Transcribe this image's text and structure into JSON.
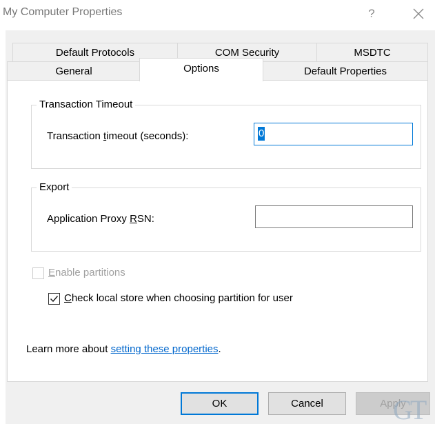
{
  "window": {
    "title": "My Computer Properties",
    "help_glyph": "?"
  },
  "tabs": {
    "row1": [
      "Default Protocols",
      "COM Security",
      "MSDTC"
    ],
    "row2": [
      "General",
      "Options",
      "Default Properties"
    ],
    "active": "Options"
  },
  "transaction_timeout": {
    "legend": "Transaction Timeout",
    "label_before": "Transaction ",
    "label_mnemonic": "t",
    "label_after": "imeout (seconds):",
    "value": "0"
  },
  "export": {
    "legend": "Export",
    "label_before": "Application Proxy ",
    "label_mnemonic": "R",
    "label_after": "SN:",
    "value": ""
  },
  "checkboxes": {
    "enable_partitions": {
      "mnemonic": "E",
      "rest": "nable partitions",
      "checked": false,
      "enabled": false
    },
    "check_local_store": {
      "mnemonic": "C",
      "rest": "heck local store when choosing partition for user",
      "checked": true,
      "enabled": true
    }
  },
  "learn_more": {
    "prefix": "Learn more about ",
    "link_text": "setting these properties",
    "suffix": "."
  },
  "buttons": {
    "ok": "OK",
    "cancel": "Cancel",
    "apply": "Apply"
  },
  "watermark": "GT",
  "colors": {
    "accent": "#0078d7",
    "link": "#0066cc",
    "dialog_bg": "#f0f0f0"
  }
}
